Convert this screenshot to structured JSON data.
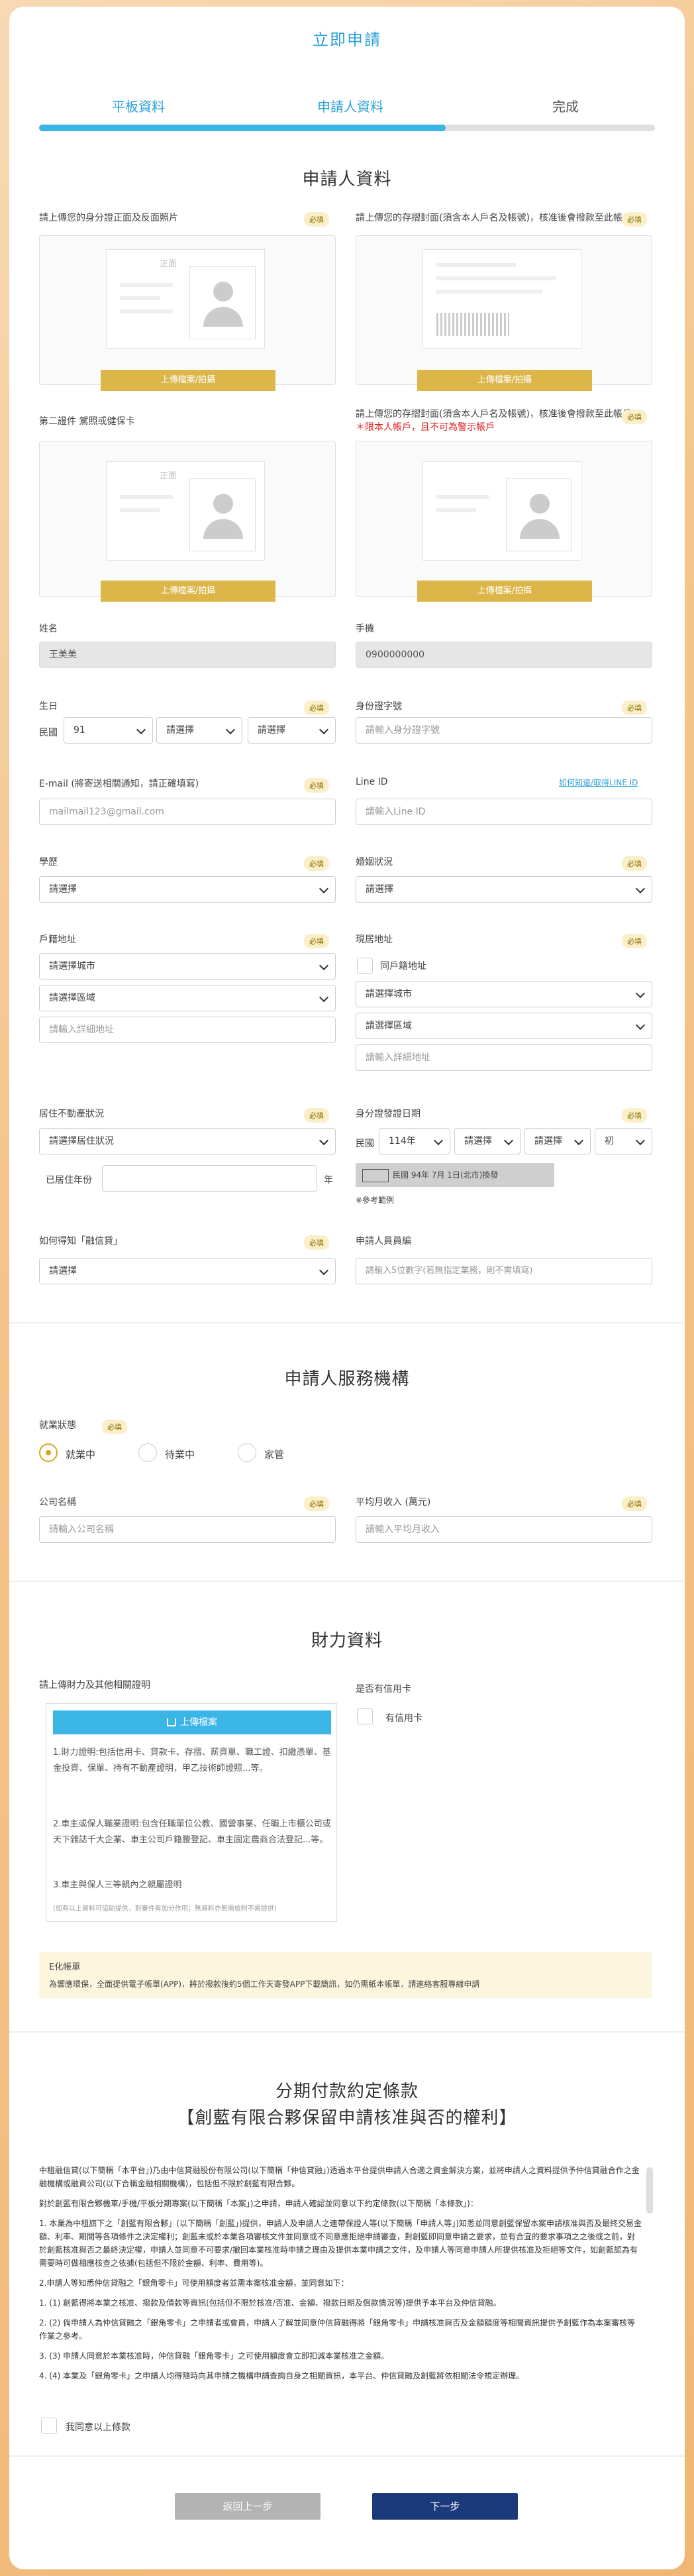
{
  "header": {
    "title": "立即申請"
  },
  "steps": [
    {
      "label": "平板資料",
      "color": "#2aa0d9"
    },
    {
      "label": "申請人資料",
      "color": "#2aa0d9"
    },
    {
      "label": "完成",
      "color": "#555555"
    }
  ],
  "progress": 0.66,
  "applicant": {
    "section_title": "申請人資料",
    "required_tag": "必填",
    "id_upload_label": "請上傳您的身分證正面及反面照片",
    "bankbook_label": "請上傳您的存摺封面(須含本人戶名及帳號)，核准後會撥款至此帳戶",
    "bankbook_warning": "＊限本人帳戶，且不可為警示帳戶",
    "second_id_label": "第二證件 駕照或健保卡",
    "upload_button": "上傳檔案/拍攝",
    "id_card_word": "正面",
    "name_label": "姓名",
    "name_value": "王美美",
    "phone_label": "手機",
    "phone_value": "0900000000",
    "birthday_label": "生日",
    "birthday_era": "民國",
    "birthday_year": "91",
    "select_placeholder": "請選擇",
    "idno_label": "身份證字號",
    "idno_placeholder": "請輸入身分證字號",
    "email_label": "E-mail (將寄送相關通知，請正確填寫)",
    "email_placeholder": "mailmail123@gmail.com",
    "line_label": "Line ID",
    "line_help": "如何知道/取得LINE ID",
    "line_placeholder": "請輸入Line ID",
    "education_label": "學歷",
    "marital_label": "婚姻狀況",
    "household_label": "戶籍地址",
    "city_placeholder": "請選擇城市",
    "district_placeholder": "請選擇區域",
    "address_placeholder": "請輸入詳細地址",
    "current_label": "現居地址",
    "same_as_household": "同戶籍地址",
    "residence_label": "居住不動產狀況",
    "residence_placeholder": "請選擇居住狀況",
    "years_label": "已居住年份",
    "years_unit": "年",
    "issue_label": "身分證發證日期",
    "issue_era": "民國",
    "issue_year": "114年",
    "issue_type": "初",
    "issue_example": "民國 94年 7月 1日(北市)換發",
    "issue_example_note": "※參考範例",
    "source_label": "如何得知「融信貸」",
    "staff_label": "申請人員員編",
    "staff_placeholder": "請輸入5位數字(若無指定業務，則不需填寫)"
  },
  "service": {
    "section_title": "申請人服務機構",
    "status_label": "就業狀態",
    "required_tag": "必填",
    "options": [
      "就業中",
      "待業中",
      "家管"
    ],
    "company_label": "公司名稱",
    "company_placeholder": "請輸入公司名稱",
    "income_label": "平均月收入 (萬元)",
    "income_placeholder": "請輸入平均月收入"
  },
  "finance": {
    "section_title": "財力資料",
    "upload_label": "請上傳財力及其他相關證明",
    "upload_button": "上傳檔案",
    "items": [
      "1.財力證明:包括信用卡、貸款卡、存摺、薪資單、職工證、扣繳憑單、基金投資、保單、持有不動產證明，甲乙技術師證照...等。",
      "2.車主或保人職業證明:包含任職單位公教、國營事業、任職上市櫃公司或天下雜誌千大企業、車主公司戶籍謄登記、車主固定農商合法登記...等。",
      "3.車主與保人三等親內之親屬證明"
    ],
    "upload_note": "(如有以上資料可協助提供，對審件有加分作用；無資料亦無需檢附不需提供)",
    "credit_card_label": "是否有信用卡",
    "credit_card_option": "有信用卡",
    "ebill_title": "E化帳單",
    "ebill_text": "為響應環保，全面提供電子帳單(APP)，將於撥款後約5個工作天寄發APP下載簡訊，如仍需紙本帳單，請連絡客服專線申請"
  },
  "terms": {
    "title": "分期付款約定條款",
    "subtitle": "【創藍有限合夥保留申請核准與否的權利】",
    "paragraphs": [
      "中租融信貸(以下簡稱「本平台」)乃由中信貸融股份有限公司(以下簡稱「仲信貸融」)透過本平台提供申請人合適之資金解決方案，並將申請人之資料提供予仲信貸融合作之金融機構或融資公司(以下合稱金融相關機構)，包括但不限於創藍有限合夥。",
      "對於創藍有限合夥機車/手機/平板分期專案(以下簡稱「本案」)之申請，申請人確認並同意以下約定條款(以下簡稱「本條款」)：",
      "1. 本業為中租旗下之「創藍有限合夥」(以下簡稱「創藍」)提供，申請人及申請人之連帶保證人等(以下簡稱「申請人等」)知悉並同意創藍保留本案申請核准與否及最終交易金額、利率、期間等各項條件之決定權利；創藍未或於本業各項審核文件並同意或不同意應拒絕申請審查，對創藍即同意申請之要求，並有合宜的要求事項之之後或之前，對於創藍核准與否之最終決定權，申請人並同意不可要求/撤回本業核准時申請之理由及提供本業申請之文件，及申請人等同意申請人所提供核准及拒絕等文件，如創藍認為有需要時可做相應核查之依據(包括但不限於金額、利率、費用等)。",
      "2.申請人等知悉仲信貸融之「銀角零卡」可使用額度者並需本案核准金額，並同意如下：",
      "1. (1) 創藍得將本業之核准、撥款及債款等資訊(包括但不限於核准/否准、金額、撥款日期及償款情況等)提供予本平台及仲信貸融。",
      "2. (2) 倘申請人為仲信貸融之「銀角零卡」之申請者或會員，申請人了解並同意仲信貸融得將「銀角零卡」申請核准與否及金額額度等相關資訊提供予創藍作為本案審核等作業之參考。",
      "3. (3) 申請人同意於本業核准時，仲信貸融「銀角零卡」之可使用額度會立即扣減本業核准之金額。",
      "4. (4) 本業及「銀角零卡」之申請人均得隨時向其申請之機構申請查詢自身之相關資訊，本平台、仲信貸融及創藍將依相關法令規定辦理。"
    ],
    "agree_label": "我同意以上條款"
  },
  "nav": {
    "prev": "返回上一步",
    "next": "下一步"
  },
  "colors": {
    "accent": "#2aa0d9",
    "upload_gold": "#ddb64a",
    "next_button": "#1b3a7a",
    "prev_button": "#b3b3b3"
  }
}
